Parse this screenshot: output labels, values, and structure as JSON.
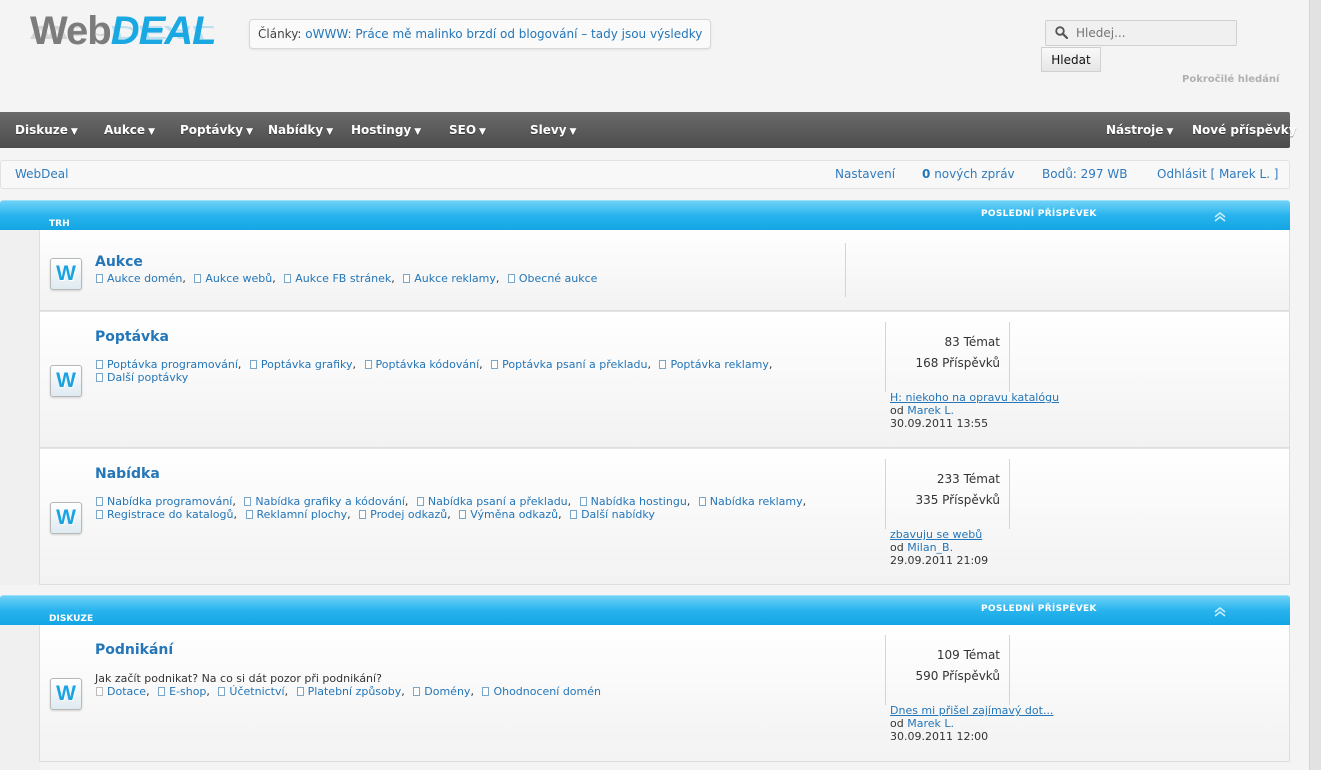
{
  "header": {
    "logo_web": "Web",
    "logo_deal": "DEAL",
    "articles_label": "Články:",
    "articles_link": "oWWW: Práce mě malinko brzdí od blogování – tady jsou výsledky",
    "search_placeholder": "Hledej...",
    "search_button": "Hledat",
    "advanced_search": "Pokročilé hledání"
  },
  "nav": {
    "left": [
      "Diskuze",
      "Aukce",
      "Poptávky",
      "Nabídky",
      "Hostingy",
      "SEO",
      "Slevy"
    ],
    "arrow": "▼",
    "tools": "Nástroje",
    "new_posts": "Nové příspěvky"
  },
  "userbar": {
    "home": "WebDeal",
    "settings": "Nastavení",
    "new_msgs_count": "0",
    "new_msgs_label": "nových zpráv",
    "points": "Bodů: 297 WB",
    "logout": "Odhlásit [ Marek L. ]"
  },
  "categories": [
    {
      "title": "TRH",
      "last_post_label": "POSLEDNÍ PŘÍSPĚVEK"
    },
    {
      "title": "DISKUZE",
      "last_post_label": "POSLEDNÍ PŘÍSPĚVEK"
    }
  ],
  "forums": [
    {
      "icon": "W",
      "title": "Aukce",
      "subforums": [
        "Aukce domén",
        "Aukce webů",
        "Aukce FB stránek",
        "Aukce reklamy",
        "Obecné aukce"
      ]
    },
    {
      "icon": "W",
      "title": "Poptávka",
      "subforums": [
        "Poptávka programování",
        "Poptávka grafiky",
        "Poptávka kódování",
        "Poptávka psaní a překladu",
        "Poptávka reklamy",
        "Další poptávky"
      ],
      "topics": "83 Témat",
      "posts": "168 Příspěvků",
      "last_title": "H: niekoho na opravu katalógu",
      "last_by": "od",
      "last_user": "Marek L.",
      "last_date": "30.09.2011 13:55"
    },
    {
      "icon": "W",
      "title": "Nabídka",
      "subforums": [
        "Nabídka programování",
        "Nabídka grafiky a kódování",
        "Nabídka psaní a překladu",
        "Nabídka hostingu",
        "Nabídka reklamy",
        "Registrace do katalogů",
        "Reklamní plochy",
        "Prodej odkazů",
        "Výměna odkazů",
        "Další nabídky"
      ],
      "topics": "233 Témat",
      "posts": "335 Příspěvků",
      "last_title": "zbavuju se webů",
      "last_by": "od",
      "last_user": "Milan_B.",
      "last_date": "29.09.2011 21:09"
    },
    {
      "icon": "W",
      "title": "Podnikání",
      "description": "Jak začít podnikat? Na co si dát pozor při podnikání?",
      "subforums": [
        "Dotace",
        "E-shop",
        "Účetnictví",
        "Platební způsoby",
        "Domény",
        "Ohodnocení domén"
      ],
      "topics": "109 Témat",
      "posts": "590 Příspěvků",
      "last_title": "Dnes mi přišel zajímavý dot...",
      "last_by": "od",
      "last_user": "Marek L.",
      "last_date": "30.09.2011 12:00"
    }
  ],
  "colors": {
    "accent": "#1aa8e2",
    "link": "#2476b8",
    "nav": "#555555"
  }
}
